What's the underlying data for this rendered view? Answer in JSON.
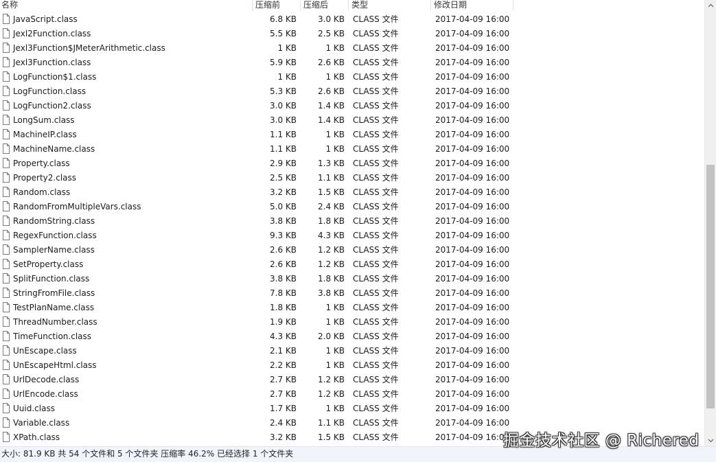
{
  "columns": {
    "name": "名称",
    "before": "压缩前",
    "after": "压缩后",
    "type": "类型",
    "date": "修改日期"
  },
  "files": [
    {
      "name": "JavaScript.class",
      "before": "6.8 KB",
      "after": "3.0 KB",
      "type": "CLASS 文件",
      "date": "2017-04-09 16:00"
    },
    {
      "name": "Jexl2Function.class",
      "before": "5.5 KB",
      "after": "2.5 KB",
      "type": "CLASS 文件",
      "date": "2017-04-09 16:00"
    },
    {
      "name": "Jexl3Function$JMeterArithmetic.class",
      "before": "1 KB",
      "after": "1 KB",
      "type": "CLASS 文件",
      "date": "2017-04-09 16:00"
    },
    {
      "name": "Jexl3Function.class",
      "before": "5.9 KB",
      "after": "2.6 KB",
      "type": "CLASS 文件",
      "date": "2017-04-09 16:00"
    },
    {
      "name": "LogFunction$1.class",
      "before": "1 KB",
      "after": "1 KB",
      "type": "CLASS 文件",
      "date": "2017-04-09 16:00"
    },
    {
      "name": "LogFunction.class",
      "before": "5.3 KB",
      "after": "2.6 KB",
      "type": "CLASS 文件",
      "date": "2017-04-09 16:00"
    },
    {
      "name": "LogFunction2.class",
      "before": "3.0 KB",
      "after": "1.4 KB",
      "type": "CLASS 文件",
      "date": "2017-04-09 16:00"
    },
    {
      "name": "LongSum.class",
      "before": "3.0 KB",
      "after": "1.4 KB",
      "type": "CLASS 文件",
      "date": "2017-04-09 16:00"
    },
    {
      "name": "MachineIP.class",
      "before": "1.1 KB",
      "after": "1 KB",
      "type": "CLASS 文件",
      "date": "2017-04-09 16:00"
    },
    {
      "name": "MachineName.class",
      "before": "1.1 KB",
      "after": "1 KB",
      "type": "CLASS 文件",
      "date": "2017-04-09 16:00"
    },
    {
      "name": "Property.class",
      "before": "2.9 KB",
      "after": "1.3 KB",
      "type": "CLASS 文件",
      "date": "2017-04-09 16:00"
    },
    {
      "name": "Property2.class",
      "before": "2.5 KB",
      "after": "1.1 KB",
      "type": "CLASS 文件",
      "date": "2017-04-09 16:00"
    },
    {
      "name": "Random.class",
      "before": "3.2 KB",
      "after": "1.5 KB",
      "type": "CLASS 文件",
      "date": "2017-04-09 16:00"
    },
    {
      "name": "RandomFromMultipleVars.class",
      "before": "5.0 KB",
      "after": "2.4 KB",
      "type": "CLASS 文件",
      "date": "2017-04-09 16:00"
    },
    {
      "name": "RandomString.class",
      "before": "3.8 KB",
      "after": "1.8 KB",
      "type": "CLASS 文件",
      "date": "2017-04-09 16:00"
    },
    {
      "name": "RegexFunction.class",
      "before": "9.3 KB",
      "after": "4.3 KB",
      "type": "CLASS 文件",
      "date": "2017-04-09 16:00"
    },
    {
      "name": "SamplerName.class",
      "before": "2.6 KB",
      "after": "1.2 KB",
      "type": "CLASS 文件",
      "date": "2017-04-09 16:00"
    },
    {
      "name": "SetProperty.class",
      "before": "2.6 KB",
      "after": "1.2 KB",
      "type": "CLASS 文件",
      "date": "2017-04-09 16:00"
    },
    {
      "name": "SplitFunction.class",
      "before": "3.8 KB",
      "after": "1.8 KB",
      "type": "CLASS 文件",
      "date": "2017-04-09 16:00"
    },
    {
      "name": "StringFromFile.class",
      "before": "7.8 KB",
      "after": "3.8 KB",
      "type": "CLASS 文件",
      "date": "2017-04-09 16:00"
    },
    {
      "name": "TestPlanName.class",
      "before": "1.8 KB",
      "after": "1 KB",
      "type": "CLASS 文件",
      "date": "2017-04-09 16:00"
    },
    {
      "name": "ThreadNumber.class",
      "before": "1.9 KB",
      "after": "1 KB",
      "type": "CLASS 文件",
      "date": "2017-04-09 16:00"
    },
    {
      "name": "TimeFunction.class",
      "before": "4.3 KB",
      "after": "2.0 KB",
      "type": "CLASS 文件",
      "date": "2017-04-09 16:00"
    },
    {
      "name": "UnEscape.class",
      "before": "2.1 KB",
      "after": "1 KB",
      "type": "CLASS 文件",
      "date": "2017-04-09 16:00"
    },
    {
      "name": "UnEscapeHtml.class",
      "before": "2.2 KB",
      "after": "1 KB",
      "type": "CLASS 文件",
      "date": "2017-04-09 16:00"
    },
    {
      "name": "UrlDecode.class",
      "before": "2.7 KB",
      "after": "1.2 KB",
      "type": "CLASS 文件",
      "date": "2017-04-09 16:00"
    },
    {
      "name": "UrlEncode.class",
      "before": "2.7 KB",
      "after": "1.2 KB",
      "type": "CLASS 文件",
      "date": "2017-04-09 16:00"
    },
    {
      "name": "Uuid.class",
      "before": "1.7 KB",
      "after": "1 KB",
      "type": "CLASS 文件",
      "date": "2017-04-09 16:00"
    },
    {
      "name": "Variable.class",
      "before": "2.4 KB",
      "after": "1.1 KB",
      "type": "CLASS 文件",
      "date": "2017-04-09 16:00"
    },
    {
      "name": "XPath.class",
      "before": "3.2 KB",
      "after": "1.5 KB",
      "type": "CLASS 文件",
      "date": "2017-04-09 16:00"
    }
  ],
  "status": {
    "text": "大小: 81.9 KB 共 54 个文件和 5 个文件夹 压缩率 46.2% 已经选择 1 个文件夹"
  },
  "watermark": {
    "text": "掘金技术社区 @ Richered"
  },
  "icons": {
    "file": "file-icon",
    "scroll_up": "chevron-up-icon",
    "scroll_down": "chevron-down-icon"
  }
}
